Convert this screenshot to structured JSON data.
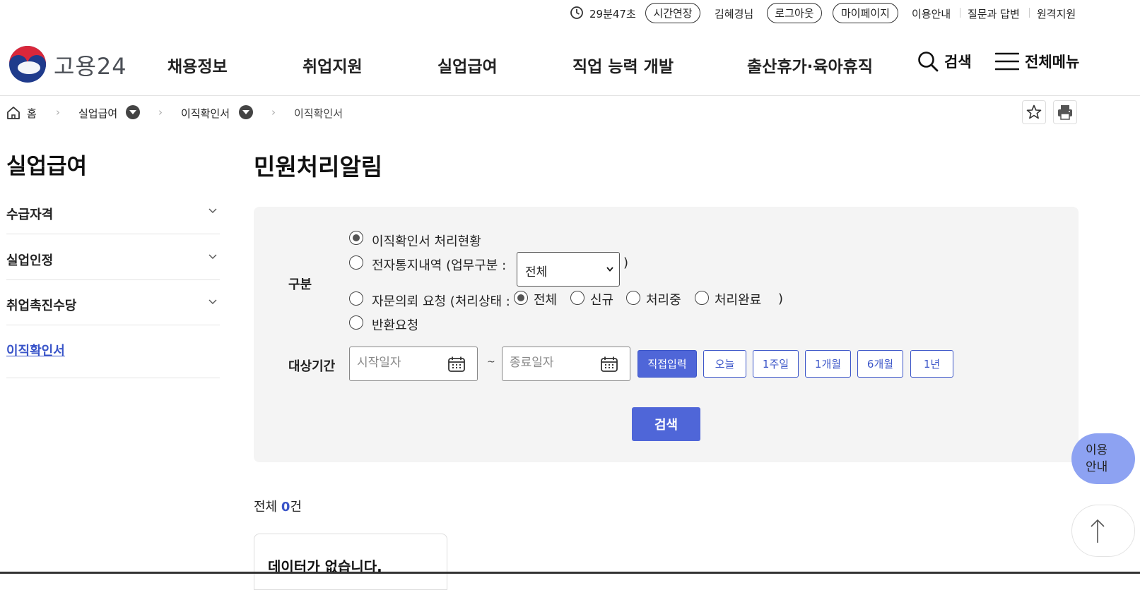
{
  "util": {
    "timer": "29분47초",
    "extend_label": "시간연장",
    "user": "김혜경님",
    "logout_label": "로그아웃",
    "mypage_label": "마이페이지",
    "links": [
      "이용안내",
      "질문과 답변",
      "원격지원"
    ]
  },
  "header": {
    "logo_text": "고용24",
    "nav": [
      "채용정보",
      "취업지원",
      "실업급여",
      "직업 능력 개발",
      "출산휴가·육아휴직"
    ],
    "search_label": "검색",
    "menu_label": "전체메뉴"
  },
  "breadcrumb": [
    "홈",
    "실업급여",
    "이직확인서",
    "이직확인서"
  ],
  "sidebar": {
    "title": "실업급여",
    "items": [
      {
        "label": "수급자격"
      },
      {
        "label": "실업인정"
      },
      {
        "label": "취업촉진수당"
      },
      {
        "label": "이직확인서"
      }
    ]
  },
  "main": {
    "title": "민원처리알림",
    "form": {
      "category_label": "구분",
      "options": [
        "이직확인서 처리현황",
        "전자통지내역 (업무구분 :",
        "자문의뢰 요청 (처리상태 :",
        "반환요청"
      ],
      "close_paren": ")",
      "business_type_value": "전체",
      "status_options": [
        "전체",
        "신규",
        "처리중",
        "처리완료"
      ],
      "period_label": "대상기간",
      "start_placeholder": "시작일자",
      "end_placeholder": "종료일자",
      "tilde": "~",
      "period_buttons": [
        "직접입력",
        "오늘",
        "1주일",
        "1개월",
        "6개월",
        "1년"
      ],
      "search_label": "검색"
    },
    "count_prefix": "전체 ",
    "count_value": "0",
    "count_suffix": "건",
    "empty_text": "데이터가 없습니다."
  },
  "float": {
    "guide_label": "이용\n안내"
  },
  "colors": {
    "primary": "#4f66d8",
    "link": "#3a55c9",
    "panel_bg": "#f4f4f4"
  }
}
